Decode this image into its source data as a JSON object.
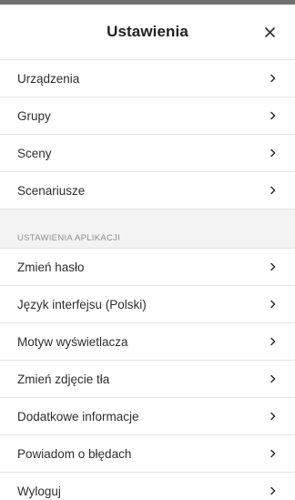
{
  "header": {
    "title": "Ustawienia",
    "close_icon": "close-icon"
  },
  "main_items": [
    {
      "label": "Urządzenia"
    },
    {
      "label": "Grupy"
    },
    {
      "label": "Sceny"
    },
    {
      "label": "Scenariusze"
    }
  ],
  "app_section": {
    "title": "USTAWIENIA APLIKACJI",
    "items": [
      {
        "label": "Zmień hasło"
      },
      {
        "label": "Język interfejsu (Polski)"
      },
      {
        "label": "Motyw wyświetlacza"
      },
      {
        "label": "Zmień zdjęcie tła"
      },
      {
        "label": "Dodatkowe informacje"
      },
      {
        "label": "Powiadom o błędach"
      },
      {
        "label": "Wyloguj"
      }
    ]
  },
  "icons": {
    "chevron": "chevron-right-icon",
    "close": "close-icon"
  },
  "colors": {
    "top_bar": "#6f6f6f",
    "section_background": "#f3f3f3",
    "divider": "#e7e7e7",
    "text": "#2e2e2e",
    "section_title": "#8d8d8d"
  }
}
